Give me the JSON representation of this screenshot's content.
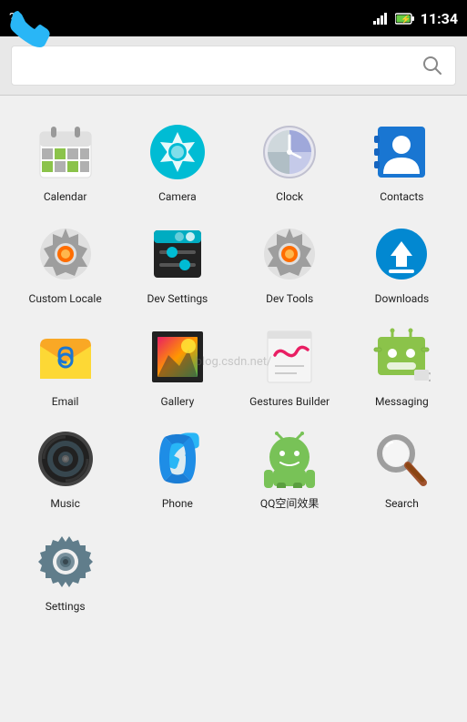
{
  "statusBar": {
    "time": "11:34",
    "wifiIcon": "wifi",
    "signalIcon": "signal",
    "batteryIcon": "battery",
    "questionIcon": "?"
  },
  "searchBar": {
    "placeholder": "",
    "searchIconLabel": "search"
  },
  "apps": [
    {
      "name": "Calendar",
      "icon": "calendar"
    },
    {
      "name": "Camera",
      "icon": "camera"
    },
    {
      "name": "Clock",
      "icon": "clock"
    },
    {
      "name": "Contacts",
      "icon": "contacts"
    },
    {
      "name": "Custom Locale",
      "icon": "custom-locale"
    },
    {
      "name": "Dev Settings",
      "icon": "dev-settings"
    },
    {
      "name": "Dev Tools",
      "icon": "dev-tools"
    },
    {
      "name": "Downloads",
      "icon": "downloads"
    },
    {
      "name": "Email",
      "icon": "email"
    },
    {
      "name": "Gallery",
      "icon": "gallery"
    },
    {
      "name": "Gestures Builder",
      "icon": "gestures-builder"
    },
    {
      "name": "Messaging",
      "icon": "messaging"
    },
    {
      "name": "Music",
      "icon": "music"
    },
    {
      "name": "Phone",
      "icon": "phone"
    },
    {
      "name": "QQ空间效果",
      "icon": "qq"
    },
    {
      "name": "Search",
      "icon": "search-app"
    },
    {
      "name": "Settings",
      "icon": "settings"
    }
  ],
  "watermark": "blog.csdn.net/"
}
